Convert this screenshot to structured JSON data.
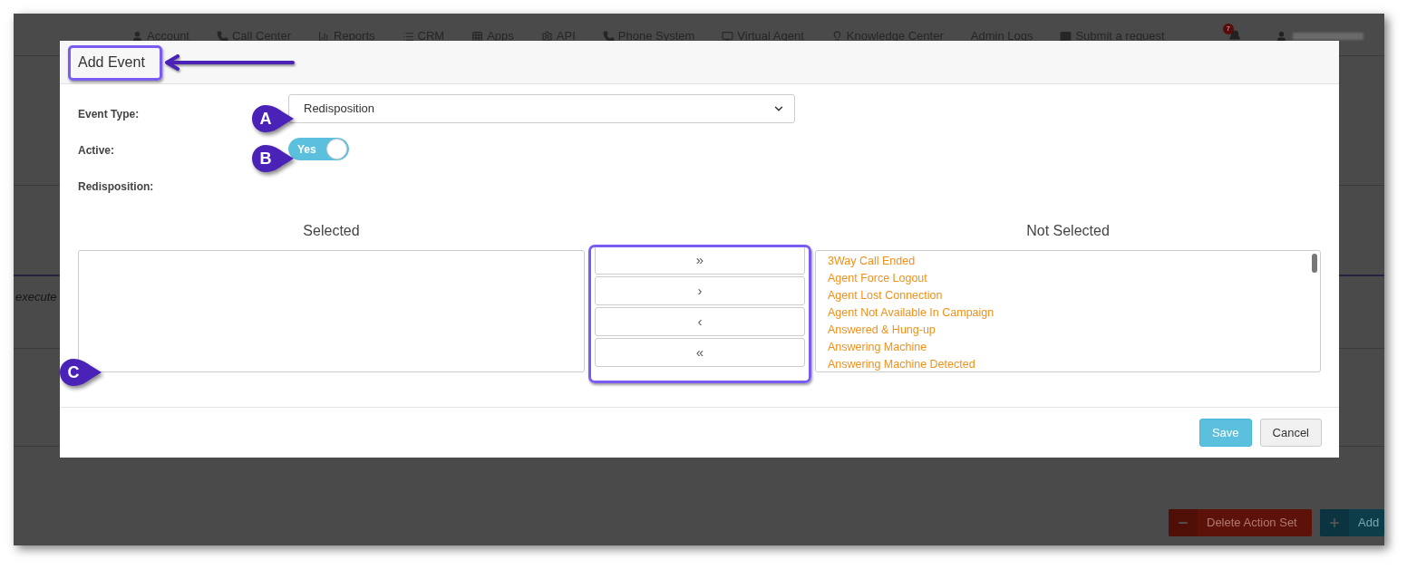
{
  "nav": {
    "items": [
      {
        "label": "Account"
      },
      {
        "label": "Call Center"
      },
      {
        "label": "Reports"
      },
      {
        "label": "CRM"
      },
      {
        "label": "Apps"
      },
      {
        "label": "API"
      },
      {
        "label": "Phone System"
      },
      {
        "label": "Virtual Agent"
      },
      {
        "label": "Knowledge Center"
      },
      {
        "label": "Admin Logs"
      },
      {
        "label": "Submit a request"
      }
    ],
    "notification_count": "7"
  },
  "background": {
    "italic_text": "execute",
    "buttons": [
      {
        "label": "Delete Action Set",
        "kind": "delete"
      },
      {
        "label": "Add",
        "kind": "add"
      }
    ]
  },
  "modal": {
    "title": "Add Event",
    "fields": [
      {
        "kind": "select",
        "label": "Event Type:",
        "value": "Redisposition"
      },
      {
        "kind": "toggle",
        "label": "Active:",
        "on": true,
        "text": "Yes"
      },
      {
        "kind": "heading",
        "label": "Redisposition:"
      }
    ],
    "dual_list": {
      "selected_heading": "Selected",
      "not_selected_heading": "Not Selected",
      "move_buttons": [
        "»",
        "›",
        "‹",
        "«"
      ],
      "not_selected_items": [
        "3Way Call Ended",
        "Agent Force Logout",
        "Agent Lost Connection",
        "Agent Not Available In Campaign",
        "Answered & Hung-up",
        "Answering Machine",
        "Answering Machine Detected"
      ]
    },
    "footer_buttons": [
      {
        "label": "Save",
        "kind": "primary"
      },
      {
        "label": "Cancel",
        "kind": "default"
      }
    ]
  },
  "annotations": {
    "callouts": [
      "A",
      "B",
      "C"
    ]
  }
}
